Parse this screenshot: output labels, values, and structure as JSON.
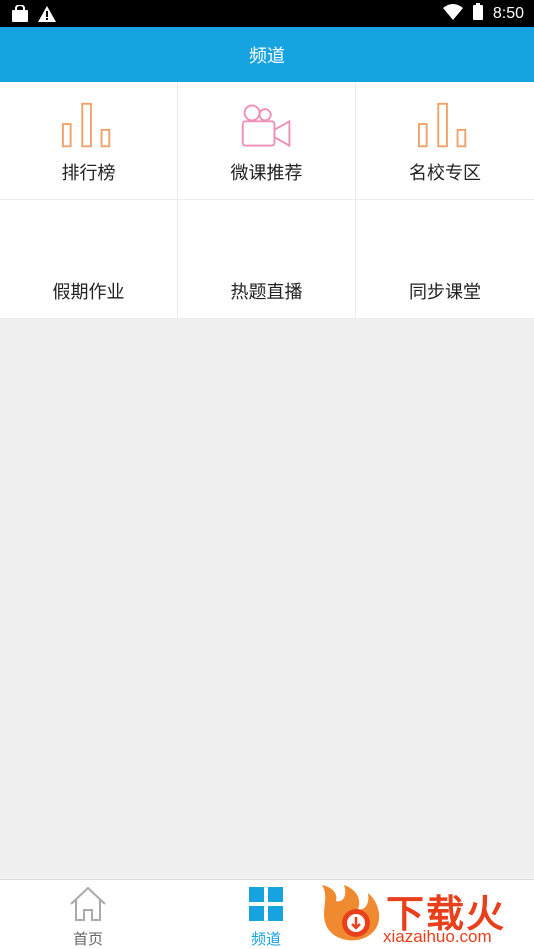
{
  "status_bar": {
    "time": "8:50",
    "icons": [
      "bag-icon",
      "warning-icon",
      "wifi-icon",
      "battery-icon"
    ]
  },
  "header": {
    "title": "频道"
  },
  "channels": [
    {
      "label": "排行榜",
      "icon": "bar-chart-icon"
    },
    {
      "label": "微课推荐",
      "icon": "video-camera-icon"
    },
    {
      "label": "名校专区",
      "icon": "bar-chart-icon"
    },
    {
      "label": "假期作业",
      "icon": ""
    },
    {
      "label": "热题直播",
      "icon": ""
    },
    {
      "label": "同步课堂",
      "icon": ""
    }
  ],
  "bottom_nav": [
    {
      "label": "首页",
      "icon": "home-icon",
      "active": false
    },
    {
      "label": "频道",
      "icon": "grid-icon",
      "active": true
    }
  ],
  "watermark": {
    "text": "下载火",
    "url": "xiazaihuo.com"
  },
  "colors": {
    "accent": "#17a2e0",
    "icon_orange": "#f0a46c",
    "icon_pink": "#ee8fb8",
    "watermark": "#e8401c"
  }
}
